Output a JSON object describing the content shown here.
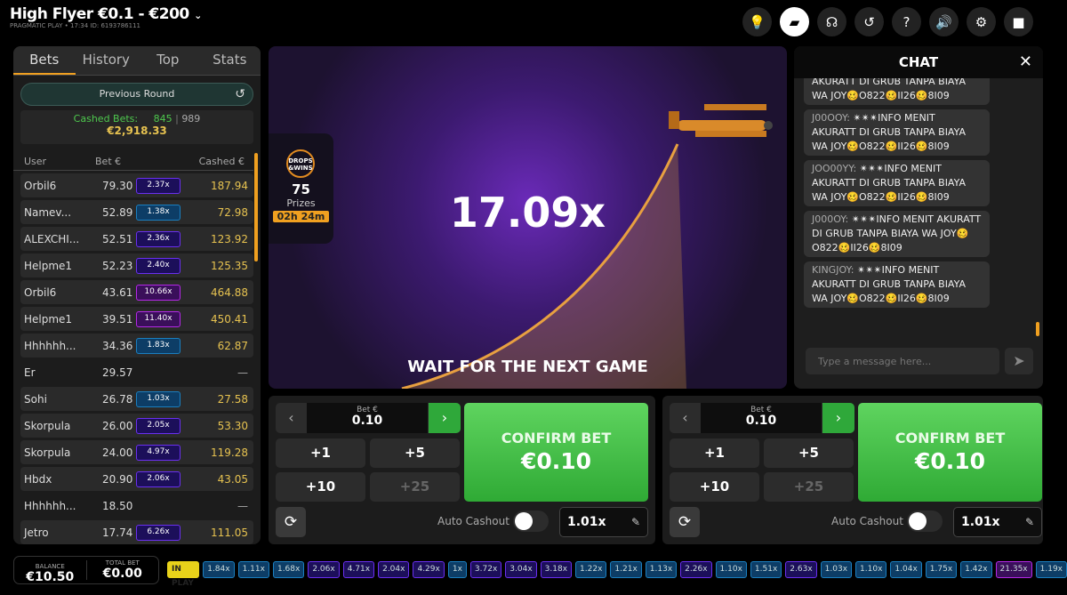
{
  "header": {
    "title": "High Flyer €0.1 - €200",
    "subtitle": "PRAGMATIC PLAY • 17:34  ID: 6193786111",
    "icons": [
      {
        "name": "tips-icon",
        "glyph": "💡"
      },
      {
        "name": "chat-icon",
        "glyph": "▰",
        "active": true
      },
      {
        "name": "support-icon",
        "glyph": "☊"
      },
      {
        "name": "history-icon",
        "glyph": "↺"
      },
      {
        "name": "help-icon",
        "glyph": "?"
      },
      {
        "name": "sound-icon",
        "glyph": "🔊"
      },
      {
        "name": "settings-icon",
        "glyph": "⚙"
      },
      {
        "name": "video-icon",
        "glyph": "■"
      }
    ]
  },
  "left": {
    "tabs": [
      "Bets",
      "History",
      "Top",
      "Stats"
    ],
    "active_tab": "Bets",
    "previous_round": "Previous Round",
    "cashed_label": "Cashed Bets:",
    "cashed_count": "845",
    "total_count": "989",
    "cashed_total": "€2,918.33",
    "columns": [
      "User",
      "Bet €",
      "Cashed €"
    ],
    "rows": [
      [
        "Orbil6",
        "79.30",
        "2.37x",
        "187.94"
      ],
      [
        "Namev...",
        "52.89",
        "1.38x",
        "72.98"
      ],
      [
        "ALEXCHI...",
        "52.51",
        "2.36x",
        "123.92"
      ],
      [
        "Helpme1",
        "52.23",
        "2.40x",
        "125.35"
      ],
      [
        "Orbil6",
        "43.61",
        "10.66x",
        "464.88"
      ],
      [
        "Helpme1",
        "39.51",
        "11.40x",
        "450.41"
      ],
      [
        "Hhhhhh...",
        "34.36",
        "1.83x",
        "62.87"
      ],
      [
        "Er",
        "29.57",
        "",
        "—"
      ],
      [
        "Sohi",
        "26.78",
        "1.03x",
        "27.58"
      ],
      [
        "Skorpula",
        "26.00",
        "2.05x",
        "53.30"
      ],
      [
        "Skorpula",
        "24.00",
        "4.97x",
        "119.28"
      ],
      [
        "Hbdx",
        "20.90",
        "2.06x",
        "43.05"
      ],
      [
        "Hhhhhh...",
        "18.50",
        "",
        "—"
      ],
      [
        "Jetro",
        "17.74",
        "6.26x",
        "111.05"
      ]
    ]
  },
  "game": {
    "multiplier": "17.09x",
    "status": "WAIT FOR THE NEXT GAME",
    "drops": {
      "logo": "DROPS & WINS",
      "count": "75",
      "label": "Prizes",
      "timer": "02h 24m"
    }
  },
  "chat": {
    "title": "CHAT",
    "placeholder": "Type a message here...",
    "messages": [
      {
        "user": "",
        "text": "AKURATT DI GRUB TANPA BIAYA WA JOY🥴O822🥴II26🥴8I09"
      },
      {
        "user": "J00OOY:",
        "text": "✴✴✴INFO MENIT AKURATT DI GRUB TANPA BIAYA WA JOY🥴O822🥴II26🥴8I09"
      },
      {
        "user": "JOO00YY:",
        "text": "✴✴✴INFO MENIT AKURATT DI GRUB TANPA BIAYA WA JOY🥴O822🥴II26🥴8I09"
      },
      {
        "user": "J000OY:",
        "text": "✴✴✴INFO MENIT AKURATT DI GRUB TANPA BIAYA WA JOY🥴O822🥴II26🥴8I09"
      },
      {
        "user": "KINGJOY:",
        "text": "✴✴✴INFO MENIT AKURATT DI GRUB TANPA BIAYA WA JOY🥴O822🥴II26🥴8I09"
      }
    ]
  },
  "bets": [
    {
      "bet_label": "Bet €",
      "bet_value": "0.10",
      "quick": [
        "+1",
        "+5",
        "+10",
        "+25"
      ],
      "confirm_label": "CONFIRM BET",
      "confirm_amount": "€0.10",
      "auto_cashout_label": "Auto Cashout",
      "auto_cashout_on": false,
      "auto_cashout_value": "1.01x"
    },
    {
      "bet_label": "Bet €",
      "bet_value": "0.10",
      "quick": [
        "+1",
        "+5",
        "+10",
        "+25"
      ],
      "confirm_label": "CONFIRM BET",
      "confirm_amount": "€0.10",
      "auto_cashout_label": "Auto Cashout",
      "auto_cashout_on": false,
      "auto_cashout_value": "1.01x"
    }
  ],
  "footer": {
    "balance_label": "BALANCE",
    "balance": "€10.50",
    "total_bet_label": "TOTAL BET",
    "total_bet": "€0.00",
    "in_play": "IN PLAY",
    "history": [
      "1.84x",
      "1.11x",
      "1.68x",
      "2.06x",
      "4.71x",
      "2.04x",
      "4.29x",
      "1x",
      "3.72x",
      "3.04x",
      "3.18x",
      "1.22x",
      "1.21x",
      "1.13x",
      "2.26x",
      "1.10x",
      "1.51x",
      "2.63x",
      "1.03x",
      "1.10x",
      "1.04x",
      "1.75x",
      "1.42x",
      "21.35x",
      "1.19x"
    ]
  },
  "colors": {
    "blue": "#1a7fc0",
    "purple": "#6a2ff0",
    "magenta": "#b528e8",
    "accent": "#f0a020",
    "green": "#2faa35",
    "gold": "#e6c250"
  }
}
